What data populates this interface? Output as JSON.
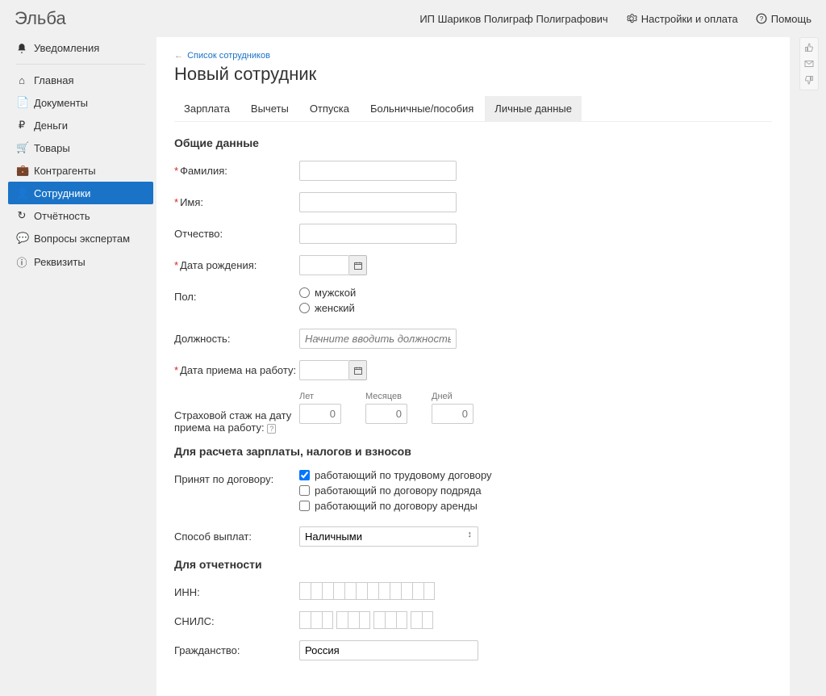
{
  "brand": "Эльба",
  "top": {
    "org": "ИП Шариков Полиграф Полиграфович",
    "settings": "Настройки и оплата",
    "help": "Помощь"
  },
  "sidebar": {
    "notifications": "Уведомления",
    "items": [
      {
        "label": "Главная",
        "icon": "home"
      },
      {
        "label": "Документы",
        "icon": "doc"
      },
      {
        "label": "Деньги",
        "icon": "money"
      },
      {
        "label": "Товары",
        "icon": "cart"
      },
      {
        "label": "Контрагенты",
        "icon": "case"
      },
      {
        "label": "Сотрудники",
        "icon": "user",
        "active": true
      },
      {
        "label": "Отчётность",
        "icon": "refresh"
      },
      {
        "label": "Вопросы экспертам",
        "icon": "chat"
      },
      {
        "label": "Реквизиты",
        "icon": "info"
      }
    ]
  },
  "page": {
    "back": "Список сотрудников",
    "title": "Новый сотрудник",
    "tabs": [
      "Зарплата",
      "Вычеты",
      "Отпуска",
      "Больничные/пособия",
      "Личные данные"
    ],
    "activeTab": 4
  },
  "sections": {
    "general": "Общие данные",
    "calc": "Для расчета зарплаты, налогов и взносов",
    "report": "Для отчетности"
  },
  "labels": {
    "surname": "Фамилия:",
    "name": "Имя:",
    "patronymic": "Отчество:",
    "birthdate": "Дата рождения:",
    "sex": "Пол:",
    "sex_m": "мужской",
    "sex_f": "женский",
    "position": "Должность:",
    "position_ph": "Начните вводить должность...",
    "hiredate": "Дата приема на работу:",
    "stazh": "Страховой стаж на дату приема на работу:",
    "years": "Лет",
    "months": "Месяцев",
    "days": "Дней",
    "zero": "0",
    "contract": "Принят по договору:",
    "c1": "работающий по трудовому договору",
    "c2": "работающий по договору подряда",
    "c3": "работающий по договору аренды",
    "paymethod": "Способ выплат:",
    "paymethod_v": "Наличными",
    "inn": "ИНН:",
    "snils": "СНИЛС:",
    "citizenship": "Гражданство:",
    "citizenship_v": "Россия"
  }
}
